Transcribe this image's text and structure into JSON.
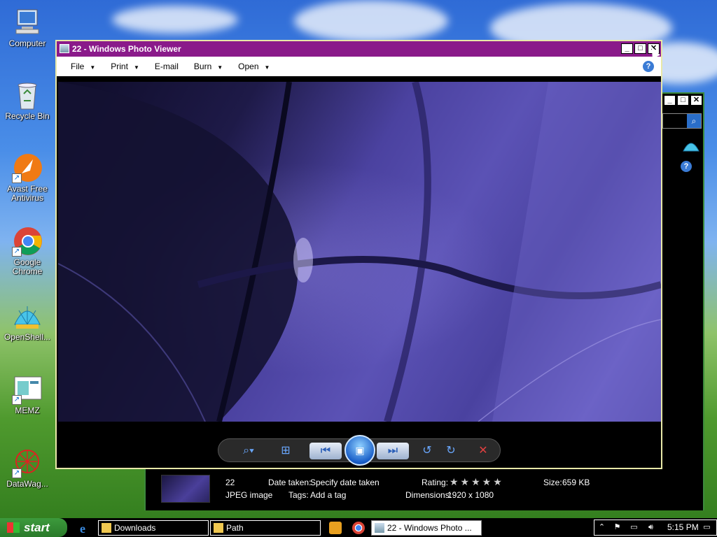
{
  "desktop": {
    "icons": [
      {
        "label": "Computer"
      },
      {
        "label": "Recycle Bin"
      },
      {
        "label": "Avast Free Antivirus"
      },
      {
        "label": "Google Chrome"
      },
      {
        "label": "OpenShell..."
      },
      {
        "label": "MEMZ"
      },
      {
        "label": "DataWag..."
      }
    ]
  },
  "photo_viewer": {
    "title": "22 - Windows Photo Viewer",
    "menu": [
      {
        "label": "File",
        "has_arrow": true
      },
      {
        "label": "Print",
        "has_arrow": true
      },
      {
        "label": "E-mail",
        "has_arrow": false
      },
      {
        "label": "Burn",
        "has_arrow": true
      },
      {
        "label": "Open",
        "has_arrow": true
      }
    ],
    "help_glyph": "?",
    "controls": {
      "zoom_icon": "magnifier-icon",
      "fit_icon": "actual-size-icon",
      "prev_icon": "previous-icon",
      "slideshow_icon": "slideshow-icon",
      "next_icon": "next-icon",
      "rotate_ccw_icon": "rotate-left-icon",
      "rotate_cw_icon": "rotate-right-icon",
      "delete_icon": "delete-icon"
    }
  },
  "details_pane": {
    "name": "22",
    "type": "JPEG image",
    "date_taken_label": "Date taken:",
    "date_taken_value": "Specify date taken",
    "tags_label": "Tags:",
    "tags_value": "Add a tag",
    "rating_label": "Rating:",
    "rating_stars": "★★★★★",
    "rating_value": 0,
    "dimensions_label": "Dimensions:",
    "dimensions_value": "1920 x 1080",
    "size_label": "Size:",
    "size_value": "659 KB"
  },
  "taskbar": {
    "start_label": "start",
    "tasks": [
      {
        "label": "Downloads"
      },
      {
        "label": "Path"
      },
      {
        "label": "22 - Windows Photo ..."
      }
    ],
    "clock": "5:15 PM"
  },
  "colors": {
    "title_bar": "#8a1a8a",
    "window_border": "#e8e8a8",
    "start_button": "#2a7a2a"
  }
}
